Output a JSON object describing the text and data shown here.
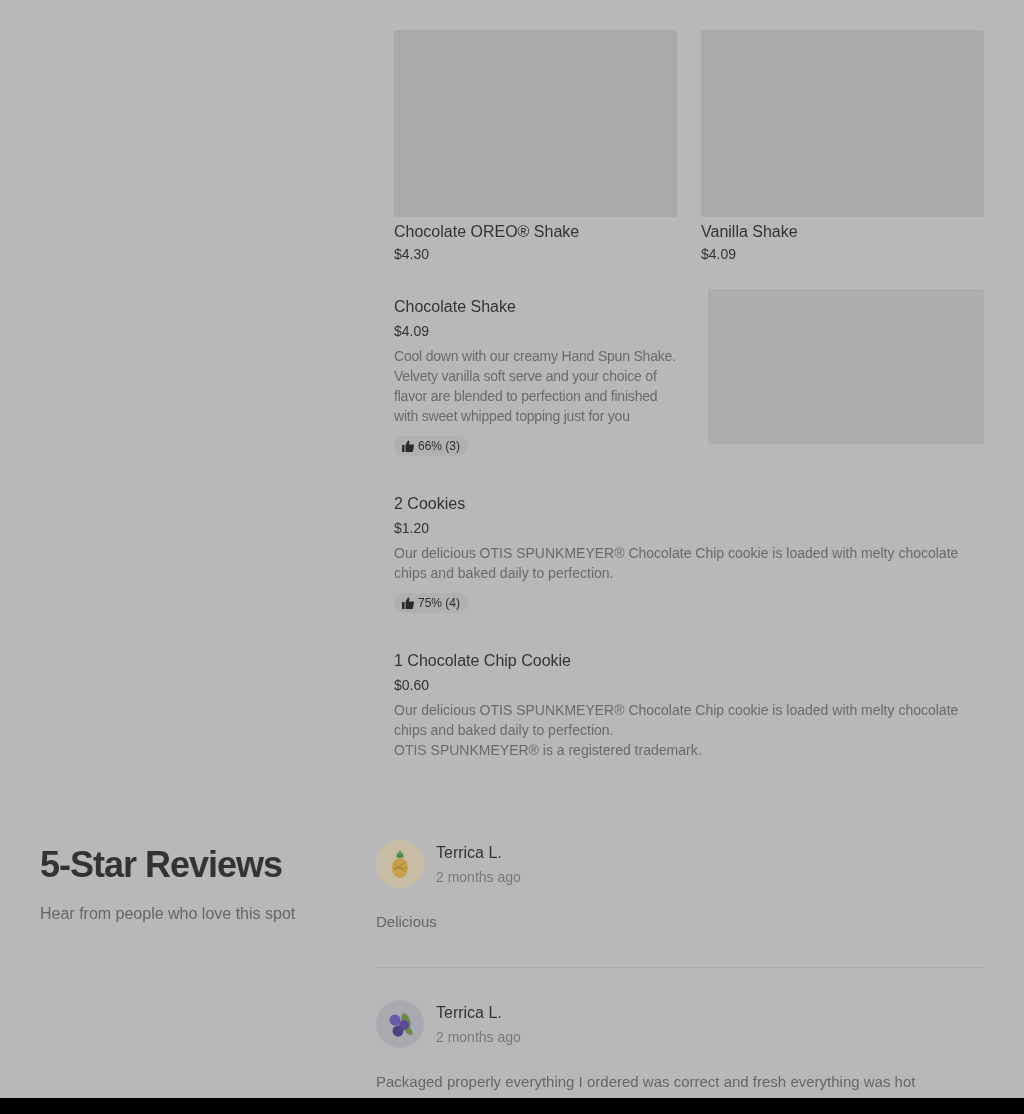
{
  "grid_items": [
    {
      "name": "Chocolate OREO® Shake",
      "price": "$4.30",
      "image": {
        "kind": "picture"
      }
    },
    {
      "name": "Vanilla Shake",
      "price": "$4.09",
      "image": {
        "kind": "picture"
      }
    }
  ],
  "list_items": [
    {
      "name": "Chocolate Shake",
      "price": "$4.09",
      "description": [
        "Cool down with our creamy Hand Spun Shake. Velvety vanilla soft serve and your choice of flavor are blended to perfection and finished with sweet whipped topping just for you"
      ],
      "rating": "66% (3)",
      "image": {
        "kind": "picture"
      }
    },
    {
      "name": "2 Cookies",
      "price": "$1.20",
      "description": [
        "Our delicious OTIS SPUNKMEYER® Chocolate Chip cookie is loaded with melty chocolate chips and baked daily to perfection."
      ],
      "rating": "75% (4)"
    },
    {
      "name": "1 Chocolate Chip Cookie",
      "price": "$0.60",
      "description": [
        "Our delicious OTIS SPUNKMEYER® Chocolate Chip cookie is loaded with melty chocolate chips and baked daily to perfection.",
        "OTIS SPUNKMEYER® is a registered trademark."
      ]
    }
  ],
  "reviews_section": {
    "title": "5-Star Reviews",
    "subtitle": "Hear from people who love this spot",
    "reviews": [
      {
        "author": "Terrica L.",
        "avatar": {
          "kind": "pineapple"
        },
        "time": "2 months ago",
        "text": "Delicious"
      },
      {
        "author": "Terrica L.",
        "avatar": {
          "kind": "blueberries"
        },
        "time": "2 months ago",
        "text": "Packaged properly everything I ordered was correct and fresh everything was hot"
      }
    ]
  }
}
